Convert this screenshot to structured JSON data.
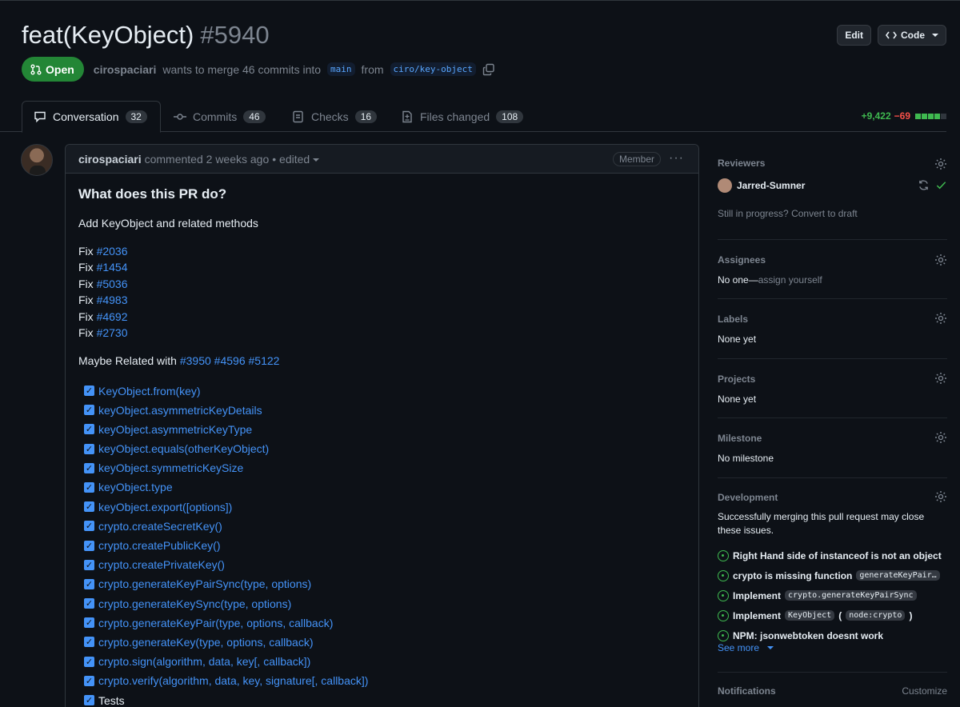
{
  "pr": {
    "title": "feat(KeyObject)",
    "number": "#5940",
    "edit_label": "Edit",
    "code_label": "Code",
    "status": "Open",
    "author": "cirospaciari",
    "merge_text": "wants to merge 46 commits into",
    "base_branch": "main",
    "from_text": "from",
    "head_branch": "ciro/key-object"
  },
  "tabs": [
    {
      "label": "Conversation",
      "count": "32"
    },
    {
      "label": "Commits",
      "count": "46"
    },
    {
      "label": "Checks",
      "count": "16"
    },
    {
      "label": "Files changed",
      "count": "108"
    }
  ],
  "diffstat": {
    "additions": "+9,422",
    "deletions": "−69"
  },
  "comment": {
    "author": "cirospaciari",
    "action": "commented 2 weeks ago",
    "edited": "• edited",
    "role": "Member",
    "heading": "What does this PR do?",
    "intro": "Add KeyObject and related methods",
    "fix_word": "Fix",
    "fixes": [
      "#2036",
      "#1454",
      "#5036",
      "#4983",
      "#4692",
      "#2730"
    ],
    "related_label": "Maybe Related with",
    "related": [
      "#3950",
      "#4596",
      "#5122"
    ],
    "tasks": [
      "KeyObject.from(key)",
      "keyObject.asymmetricKeyDetails",
      "keyObject.asymmetricKeyType",
      "keyObject.equals(otherKeyObject)",
      "keyObject.symmetricKeySize",
      "keyObject.type",
      "keyObject.export([options])",
      "crypto.createSecretKey()",
      "crypto.createPublicKey()",
      "crypto.createPrivateKey()",
      "crypto.generateKeyPairSync(type, options)",
      "crypto.generateKeySync(type, options)",
      "crypto.generateKeyPair(type, options, callback)",
      "crypto.generateKey(type, options, callback)",
      "crypto.sign(algorithm, data, key[, callback])",
      "crypto.verify(algorithm, data, key, signature[, callback])"
    ],
    "last_task": "Tests"
  },
  "sidebar": {
    "reviewers": {
      "title": "Reviewers",
      "name": "Jarred-Sumner",
      "progress_q": "Still in progress?",
      "draft_link": "Convert to draft"
    },
    "assignees": {
      "title": "Assignees",
      "none": "No one—",
      "assign": "assign yourself"
    },
    "labels": {
      "title": "Labels",
      "value": "None yet"
    },
    "projects": {
      "title": "Projects",
      "value": "None yet"
    },
    "milestone": {
      "title": "Milestone",
      "value": "No milestone"
    },
    "development": {
      "title": "Development",
      "desc": "Successfully merging this pull request may close these issues.",
      "issue1": "Right Hand side of instanceof is not an object",
      "issue2_text": "crypto is missing function",
      "issue2_code": "generateKeyPair…",
      "issue3_text": "Implement",
      "issue3_code": "crypto.generateKeyPairSync",
      "issue4_text": "Implement",
      "issue4_code1": "KeyObject",
      "issue4_open": "(",
      "issue4_code2": "node:crypto",
      "issue4_close": ")",
      "issue5": "NPM: jsonwebtoken doesnt work",
      "see_more": "See more"
    },
    "notifications": {
      "title": "Notifications",
      "customize": "Customize"
    }
  },
  "colors": {
    "accent": "#4493f8",
    "open": "#238636",
    "add": "#3fb950",
    "del": "#f85149"
  }
}
